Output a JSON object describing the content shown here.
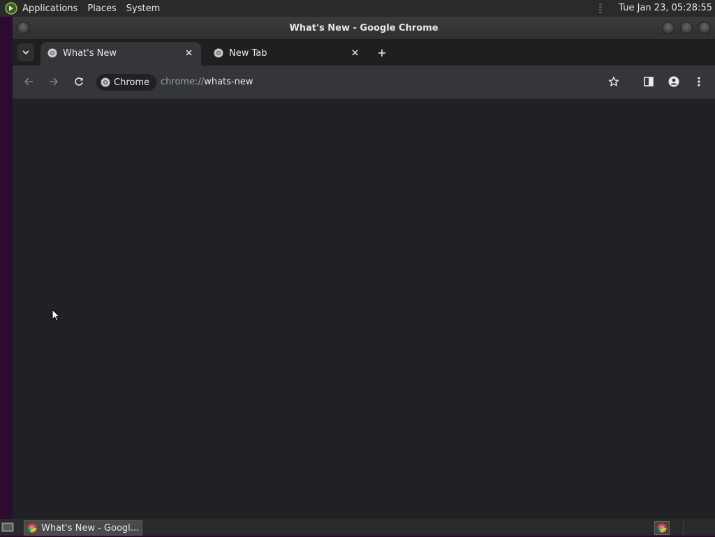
{
  "top_panel": {
    "menus": [
      "Applications",
      "Places",
      "System"
    ],
    "clock": "Tue Jan 23, 05:28:55"
  },
  "window": {
    "title": "What's New - Google Chrome"
  },
  "tabs": [
    {
      "label": "What's New",
      "active": true
    },
    {
      "label": "New Tab",
      "active": false
    }
  ],
  "toolbar": {
    "site_chip": "Chrome",
    "url_scheme": "chrome://",
    "url_rest": "whats-new"
  },
  "taskbar": {
    "task_label": "What's New - Googl..."
  },
  "colors": {
    "page_bg": "#202124",
    "toolbar_bg": "#35363a",
    "tabstrip_bg": "#1f1f1f"
  }
}
